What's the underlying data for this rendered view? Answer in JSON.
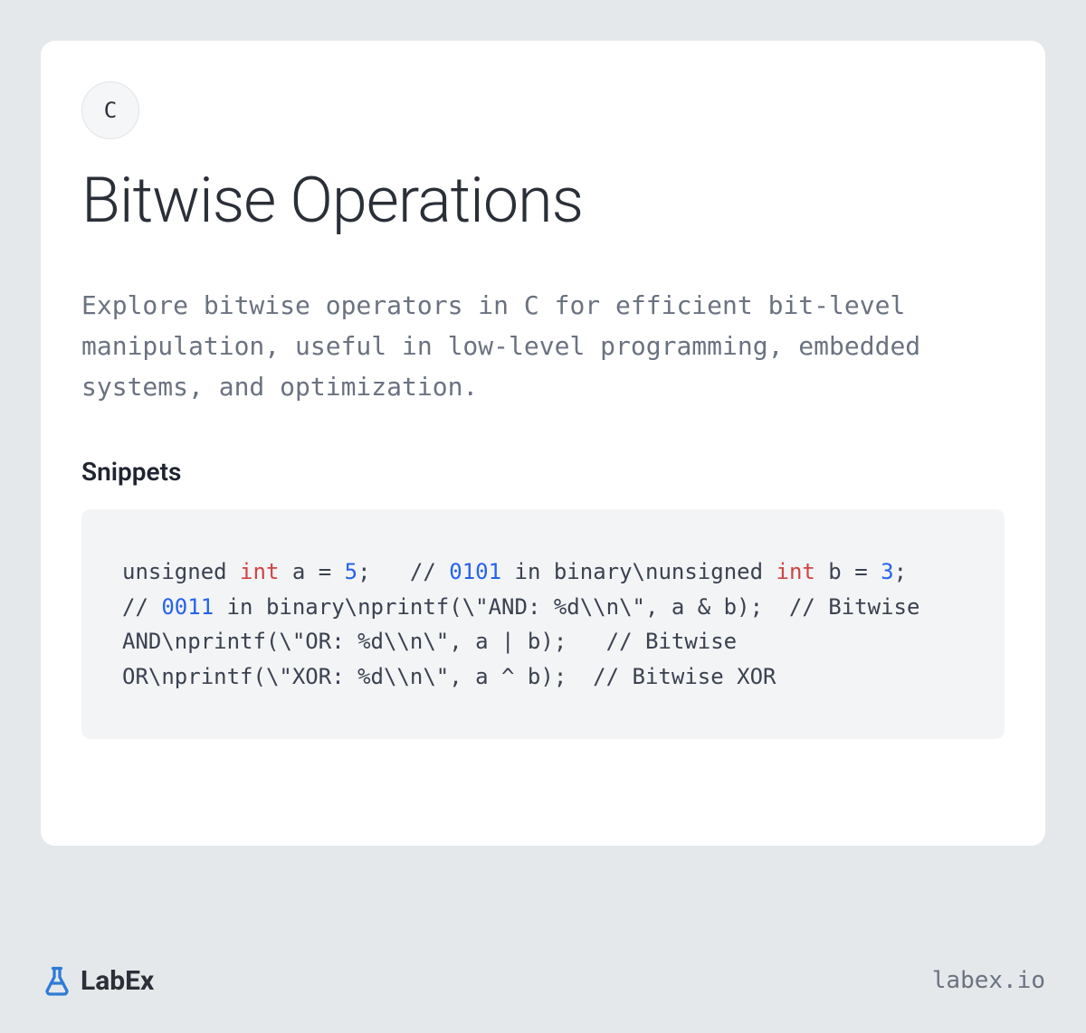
{
  "badge": "C",
  "title": "Bitwise Operations",
  "description": "Explore bitwise operators in C for efficient bit-level manipulation, useful in low-level programming, embedded systems, and optimization.",
  "snippets_heading": "Snippets",
  "code": {
    "tokens": [
      {
        "t": "unsigned ",
        "c": ""
      },
      {
        "t": "int",
        "c": "kw"
      },
      {
        "t": " a = ",
        "c": ""
      },
      {
        "t": "5",
        "c": "num"
      },
      {
        "t": ";   // ",
        "c": ""
      },
      {
        "t": "0101",
        "c": "num"
      },
      {
        "t": " in binary\\nunsigned ",
        "c": ""
      },
      {
        "t": "int",
        "c": "kw"
      },
      {
        "t": " b = ",
        "c": ""
      },
      {
        "t": "3",
        "c": "num"
      },
      {
        "t": ";   // ",
        "c": ""
      },
      {
        "t": "0011",
        "c": "num"
      },
      {
        "t": " in binary\\nprintf(\\\"AND: %d\\\\n\\\", a & b);  // Bitwise AND\\nprintf(\\\"OR: %d\\\\n\\\", a | b);   // Bitwise OR\\nprintf(\\\"XOR: %d\\\\n\\\", a ^ b);  // Bitwise XOR",
        "c": ""
      }
    ]
  },
  "footer": {
    "brand": "LabEx",
    "url": "labex.io"
  }
}
